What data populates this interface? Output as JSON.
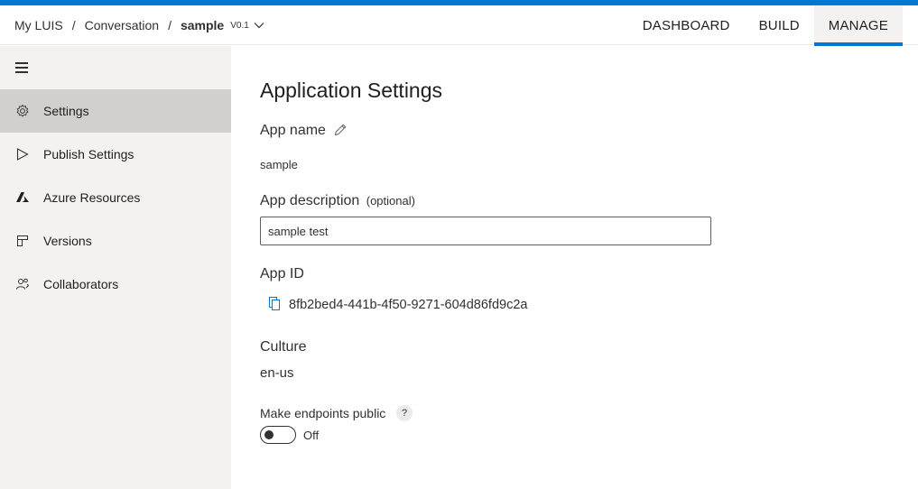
{
  "breadcrumb": {
    "root": "My LUIS",
    "section": "Conversation",
    "app": "sample",
    "version": "V0.1",
    "separator": "/"
  },
  "nav": {
    "tabs": [
      {
        "label": "DASHBOARD",
        "active": false
      },
      {
        "label": "BUILD",
        "active": false
      },
      {
        "label": "MANAGE",
        "active": true
      }
    ]
  },
  "sidebar": {
    "menu_icon": "hamburger-icon",
    "items": [
      {
        "label": "Settings",
        "icon": "gear-icon",
        "active": true
      },
      {
        "label": "Publish Settings",
        "icon": "play-icon",
        "active": false
      },
      {
        "label": "Azure Resources",
        "icon": "azure-icon",
        "active": false
      },
      {
        "label": "Versions",
        "icon": "versions-icon",
        "active": false
      },
      {
        "label": "Collaborators",
        "icon": "collaborators-icon",
        "active": false
      }
    ]
  },
  "main": {
    "title": "Application Settings",
    "app_name_label": "App name",
    "app_name_value": "sample",
    "app_description_label": "App description",
    "app_description_optional": "(optional)",
    "app_description_value": "sample test",
    "app_id_label": "App ID",
    "app_id_value": "8fb2bed4-441b-4f50-9271-604d86fd9c2a",
    "culture_label": "Culture",
    "culture_value": "en-us",
    "endpoints_label": "Make endpoints public",
    "help_glyph": "?",
    "toggle_state": "Off"
  },
  "colors": {
    "accent": "#0078d4",
    "sidebar_bg": "#f3f2f1",
    "sidebar_active": "#d2d0ce",
    "text": "#323130"
  }
}
